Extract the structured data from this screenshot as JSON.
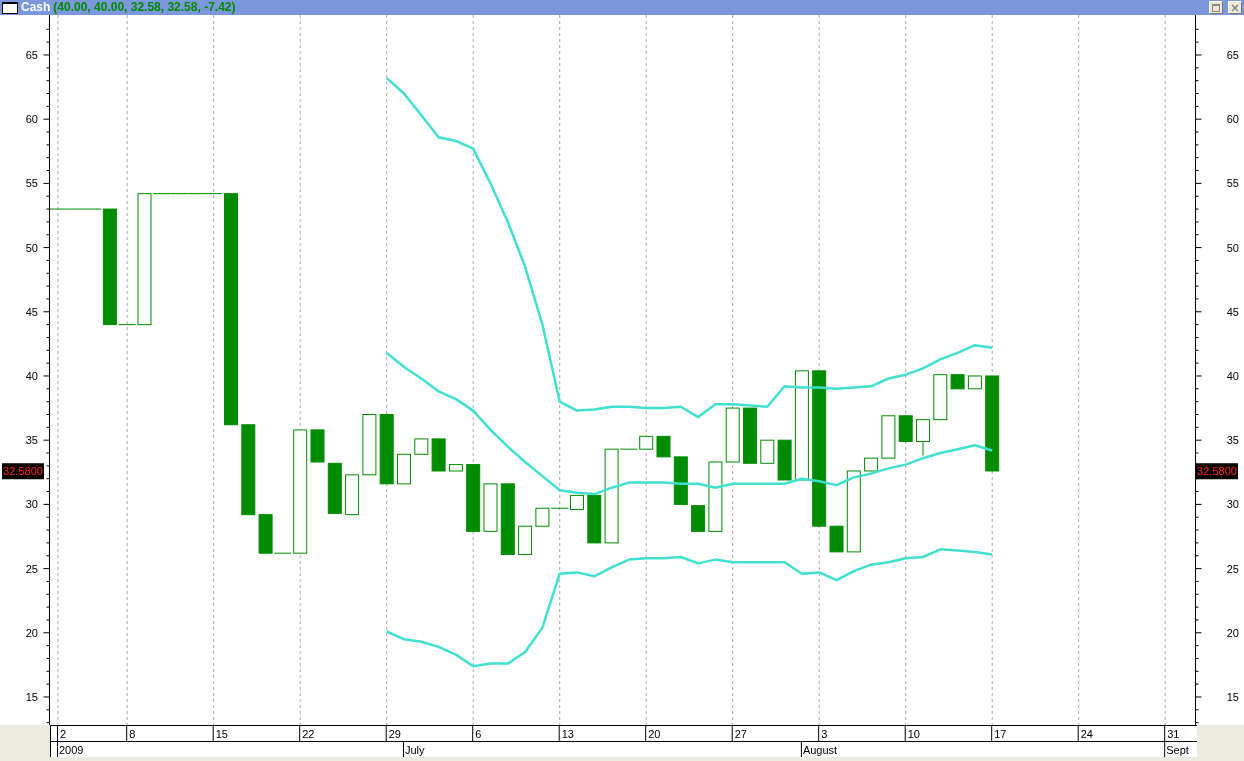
{
  "window": {
    "title": "Cash",
    "quote": "(40.00, 40.00, 32.58, 32.58, -7.42)"
  },
  "chart": {
    "left_axis": [
      "65",
      "60",
      "55",
      "50",
      "45",
      "40",
      "35",
      "30",
      "25",
      "20",
      "15"
    ],
    "right_axis": [
      "65",
      "60",
      "55",
      "50",
      "45",
      "40",
      "35",
      "30",
      "25",
      "20",
      "15"
    ],
    "price_labels": [
      "32.5800",
      "32.5800"
    ],
    "day_labels": [
      "2",
      "8",
      "15",
      "22",
      "29",
      "6",
      "13",
      "20",
      "27",
      "3",
      "10",
      "17",
      "24",
      "31"
    ],
    "month_labels": [
      "2009",
      "July",
      "August",
      "Sept"
    ]
  }
}
